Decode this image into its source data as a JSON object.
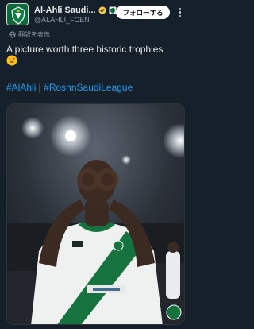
{
  "account": {
    "display_name": "Al-Ahli Saudi...",
    "handle": "@ALAHLI_FCEN",
    "avatar_icon": "al-ahli-crest-logo",
    "verified_icon": "gold-verified-badge",
    "affiliate_icon": "affiliate-badge"
  },
  "header": {
    "follow_label": "フォローする",
    "more_icon": "more-options-icon"
  },
  "translate": {
    "label": "翻訳を表示",
    "icon": "globe-icon"
  },
  "tweet": {
    "text": "A picture worth three historic trophies",
    "emoji": "heart-eyes-emoji",
    "hashtags": [
      "#AlAhli",
      "#RoshnSaudiLeague"
    ],
    "separator": "|"
  },
  "media": {
    "kind": "photo",
    "description_icon": "player-celebration-photo"
  },
  "colors": {
    "background": "#15202b",
    "text": "#e7e9ea",
    "muted": "#8b98a5",
    "link": "#1d9bf0",
    "verified": "#f4c542",
    "brand": "#0b6b3a"
  }
}
